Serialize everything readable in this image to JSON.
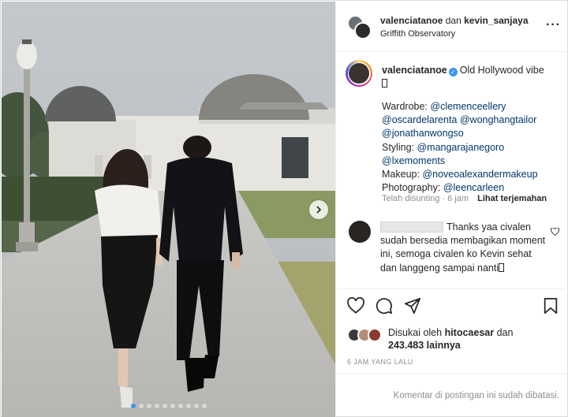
{
  "header": {
    "user_one": "valenciatanoe",
    "conjunction": "dan",
    "user_two": "kevin_sanjaya",
    "location": "Griffith Observatory",
    "more_icon": "more-horizontal-icon"
  },
  "caption": {
    "username": "valenciatanoe",
    "verified_icon": "verified-badge-icon",
    "text": "Old Hollywood vibe",
    "lines": [
      {
        "label": "Wardrobe: ",
        "mention": "@clemenceellery"
      },
      {
        "label": "",
        "mention": "@oscardelarenta @wonghangtailor"
      },
      {
        "label": "",
        "mention": "@jonathanwongso"
      },
      {
        "label": "Styling: ",
        "mention": "@mangarajanegoro"
      },
      {
        "label": "",
        "mention": "@lxemoments"
      },
      {
        "label": "Makeup: ",
        "mention": "@noveoalexandermakeup"
      },
      {
        "label": "Photography: ",
        "mention": "@leencarleen"
      }
    ],
    "edited": "Telah disunting · 6 jam",
    "translate": "Lihat terjemahan"
  },
  "comment": {
    "text": "Thanks yaa civalen sudah bersedia membagikan moment ini, semoga civalen ko Kevin sehat dan langgeng sampai nanti"
  },
  "actions": {
    "like_icon": "heart-icon",
    "comment_icon": "comment-icon",
    "share_icon": "share-icon",
    "save_icon": "bookmark-icon"
  },
  "likes": {
    "prefix": "Disukai oleh",
    "user": "hitocaesar",
    "and": "dan",
    "count": "243.483",
    "suffix": "lainnya"
  },
  "timestamp": "6 JAM YANG LALU",
  "comments_disabled": "Komentar di postingan ini sudah dibatasi.",
  "carousel": {
    "total": 10,
    "active_index": 0,
    "next_icon": "chevron-right-icon"
  },
  "colors": {
    "link": "#00376b",
    "verified": "#3897f0",
    "muted": "#8e8e8e",
    "active_dot": "#3897f0"
  }
}
